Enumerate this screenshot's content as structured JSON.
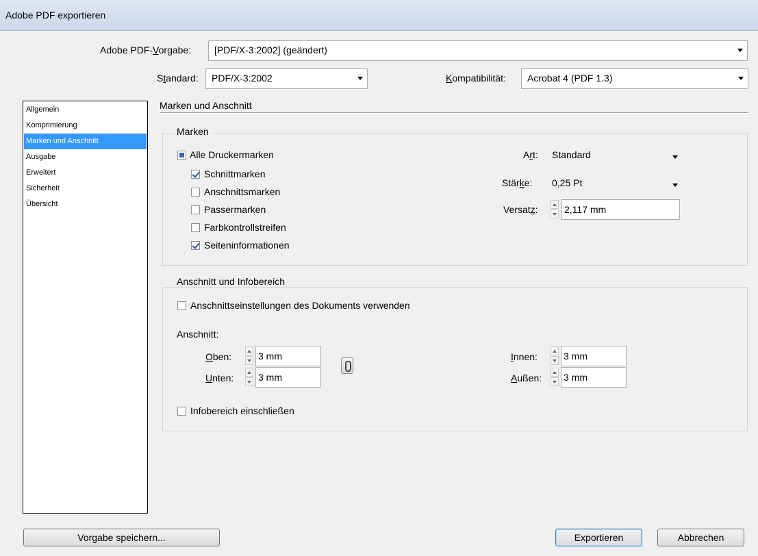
{
  "window": {
    "title": "Adobe PDF exportieren"
  },
  "preset": {
    "label_pre": "Adobe PDF-",
    "label_u": "V",
    "label_post": "orgabe:",
    "value": "[PDF/X-3:2002] (geändert)"
  },
  "standard": {
    "label_pre": "S",
    "label_u": "t",
    "label_post": "andard:",
    "value": "PDF/X-3:2002"
  },
  "compat": {
    "label_pre": "",
    "label_u": "K",
    "label_post": "ompatibilität:",
    "value": "Acrobat 4 (PDF 1.3)"
  },
  "sidebar": {
    "items": [
      {
        "label": "Allgemein"
      },
      {
        "label": "Komprimierung"
      },
      {
        "label": "Marken und Anschnitt"
      },
      {
        "label": "Ausgabe"
      },
      {
        "label": "Erweitert"
      },
      {
        "label": "Sicherheit"
      },
      {
        "label": "Übersicht"
      }
    ],
    "selected_index": 2
  },
  "section": {
    "title": "Marken und Anschnitt"
  },
  "marks": {
    "group_title": "Marken",
    "all_label": "Alle Druckermarken",
    "all_state": "mixed",
    "items": [
      {
        "label": "Schnittmarken",
        "checked": true
      },
      {
        "label": "Anschnittsmarken",
        "checked": false
      },
      {
        "label": "Passermarken",
        "checked": false
      },
      {
        "label": "Farbkontrollstreifen",
        "checked": false
      },
      {
        "label": "Seiteninformationen",
        "checked": true
      }
    ],
    "art": {
      "label_pre": "A",
      "label_u": "r",
      "label_post": "t:",
      "value": "Standard"
    },
    "staerke": {
      "label_pre": "Stär",
      "label_u": "k",
      "label_post": "e:",
      "value": "0,25 Pt"
    },
    "versatz": {
      "label_pre": "Versat",
      "label_u": "z",
      "label_post": ":",
      "value": "2,117 mm"
    }
  },
  "bleed": {
    "group_title": "Anschnitt und Infobereich",
    "use_doc_label": "Anschnittseinstellungen des Dokuments verwenden",
    "use_doc_checked": false,
    "anschnitt_label": "Anschnitt:",
    "oben": {
      "label_pre": "",
      "label_u": "O",
      "label_post": "ben:",
      "value": "3 mm"
    },
    "unten": {
      "label_pre": "",
      "label_u": "U",
      "label_post": "nten:",
      "value": "3 mm"
    },
    "innen": {
      "label_pre": "",
      "label_u": "I",
      "label_post": "nnen:",
      "value": "3 mm"
    },
    "aussen": {
      "label_pre": "",
      "label_u": "A",
      "label_post": "ußen:",
      "value": "3 mm"
    },
    "info_label": "Infobereich einschließen",
    "info_checked": false
  },
  "buttons": {
    "save_preset": "Vorgabe speichern...",
    "export": "Exportieren",
    "cancel": "Abbrechen"
  }
}
